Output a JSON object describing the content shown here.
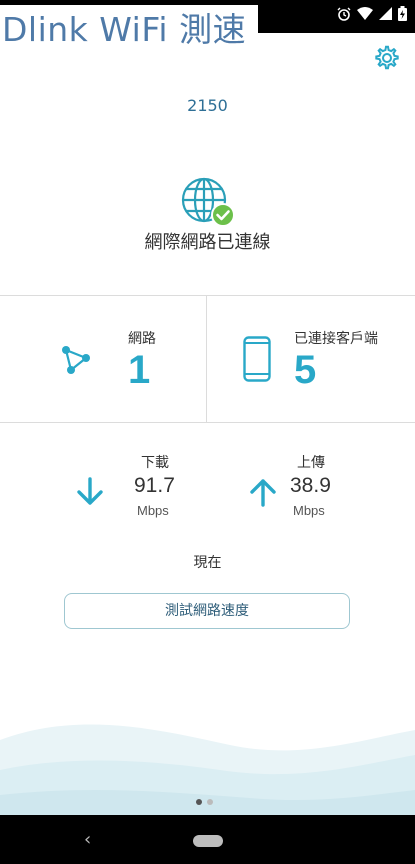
{
  "overlay": {
    "title": "Dlink WiFi 測速"
  },
  "device": {
    "name": "2150"
  },
  "connection": {
    "status": "網際網路已連線"
  },
  "stats": {
    "networks": {
      "label": "網路",
      "value": "1"
    },
    "clients": {
      "label": "已連接客戶端",
      "value": "5"
    }
  },
  "speed": {
    "download": {
      "label": "下載",
      "value": "91.7",
      "unit": "Mbps"
    },
    "upload": {
      "label": "上傳",
      "value": "38.9",
      "unit": "Mbps"
    },
    "time_label": "現在"
  },
  "actions": {
    "test_button": "測試網路速度"
  },
  "pager": {
    "total": 2,
    "active": 1
  },
  "colors": {
    "accent": "#29a8c8",
    "check": "#6cc04a",
    "title": "#4f7aa8"
  },
  "icons": {
    "settings": "gear-icon",
    "globe": "globe-icon",
    "check": "check-badge-icon",
    "network": "network-nodes-icon",
    "phone": "phone-icon",
    "download": "arrow-down-icon",
    "upload": "arrow-up-icon"
  }
}
